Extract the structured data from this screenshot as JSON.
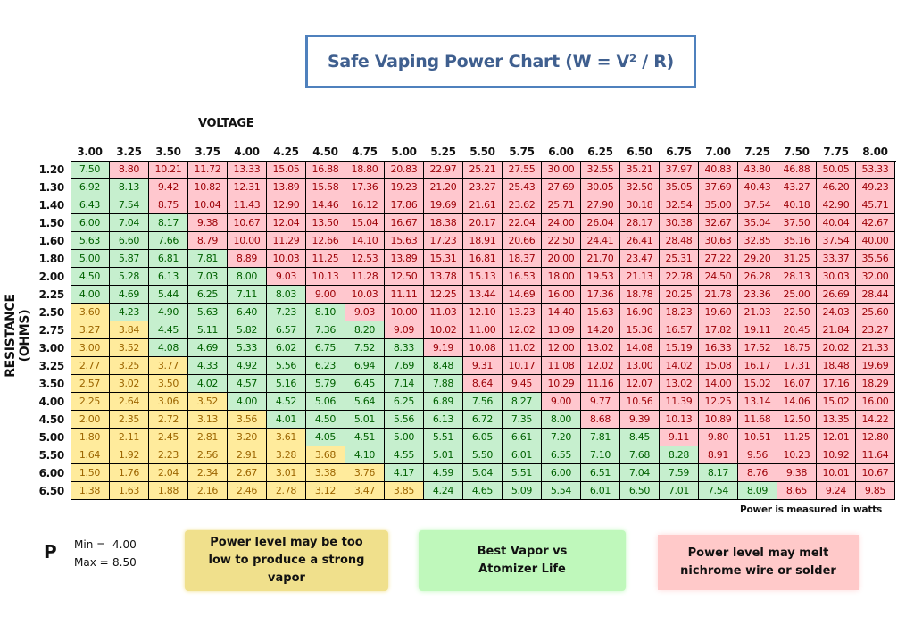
{
  "title": "Safe Vaping Power Chart (W = V² / R)",
  "chart_data": {
    "type": "table",
    "title": "Safe Vaping Power Chart (W = V² / R)",
    "xlabel": "VOLTAGE",
    "ylabel": "RESISTANCE (OHMS)",
    "units_note": "Power is measured in watts",
    "voltages": [
      "3.00",
      "3.25",
      "3.50",
      "3.75",
      "4.00",
      "4.25",
      "4.50",
      "4.75",
      "5.00",
      "5.25",
      "5.50",
      "5.75",
      "6.00",
      "6.25",
      "6.50",
      "6.75",
      "7.00",
      "7.25",
      "7.50",
      "7.75",
      "8.00"
    ],
    "resistances": [
      "1.20",
      "1.30",
      "1.40",
      "1.50",
      "1.60",
      "1.80",
      "2.00",
      "2.25",
      "2.50",
      "2.75",
      "3.00",
      "3.25",
      "3.50",
      "4.00",
      "4.50",
      "5.00",
      "5.50",
      "6.00",
      "6.50"
    ],
    "values": [
      [
        "7.50",
        "8.80",
        "10.21",
        "11.72",
        "13.33",
        "15.05",
        "16.88",
        "18.80",
        "20.83",
        "22.97",
        "25.21",
        "27.55",
        "30.00",
        "32.55",
        "35.21",
        "37.97",
        "40.83",
        "43.80",
        "46.88",
        "50.05",
        "53.33"
      ],
      [
        "6.92",
        "8.13",
        "9.42",
        "10.82",
        "12.31",
        "13.89",
        "15.58",
        "17.36",
        "19.23",
        "21.20",
        "23.27",
        "25.43",
        "27.69",
        "30.05",
        "32.50",
        "35.05",
        "37.69",
        "40.43",
        "43.27",
        "46.20",
        "49.23"
      ],
      [
        "6.43",
        "7.54",
        "8.75",
        "10.04",
        "11.43",
        "12.90",
        "14.46",
        "16.12",
        "17.86",
        "19.69",
        "21.61",
        "23.62",
        "25.71",
        "27.90",
        "30.18",
        "32.54",
        "35.00",
        "37.54",
        "40.18",
        "42.90",
        "45.71"
      ],
      [
        "6.00",
        "7.04",
        "8.17",
        "9.38",
        "10.67",
        "12.04",
        "13.50",
        "15.04",
        "16.67",
        "18.38",
        "20.17",
        "22.04",
        "24.00",
        "26.04",
        "28.17",
        "30.38",
        "32.67",
        "35.04",
        "37.50",
        "40.04",
        "42.67"
      ],
      [
        "5.63",
        "6.60",
        "7.66",
        "8.79",
        "10.00",
        "11.29",
        "12.66",
        "14.10",
        "15.63",
        "17.23",
        "18.91",
        "20.66",
        "22.50",
        "24.41",
        "26.41",
        "28.48",
        "30.63",
        "32.85",
        "35.16",
        "37.54",
        "40.00"
      ],
      [
        "5.00",
        "5.87",
        "6.81",
        "7.81",
        "8.89",
        "10.03",
        "11.25",
        "12.53",
        "13.89",
        "15.31",
        "16.81",
        "18.37",
        "20.00",
        "21.70",
        "23.47",
        "25.31",
        "27.22",
        "29.20",
        "31.25",
        "33.37",
        "35.56"
      ],
      [
        "4.50",
        "5.28",
        "6.13",
        "7.03",
        "8.00",
        "9.03",
        "10.13",
        "11.28",
        "12.50",
        "13.78",
        "15.13",
        "16.53",
        "18.00",
        "19.53",
        "21.13",
        "22.78",
        "24.50",
        "26.28",
        "28.13",
        "30.03",
        "32.00"
      ],
      [
        "4.00",
        "4.69",
        "5.44",
        "6.25",
        "7.11",
        "8.03",
        "9.00",
        "10.03",
        "11.11",
        "12.25",
        "13.44",
        "14.69",
        "16.00",
        "17.36",
        "18.78",
        "20.25",
        "21.78",
        "23.36",
        "25.00",
        "26.69",
        "28.44"
      ],
      [
        "3.60",
        "4.23",
        "4.90",
        "5.63",
        "6.40",
        "7.23",
        "8.10",
        "9.03",
        "10.00",
        "11.03",
        "12.10",
        "13.23",
        "14.40",
        "15.63",
        "16.90",
        "18.23",
        "19.60",
        "21.03",
        "22.50",
        "24.03",
        "25.60"
      ],
      [
        "3.27",
        "3.84",
        "4.45",
        "5.11",
        "5.82",
        "6.57",
        "7.36",
        "8.20",
        "9.09",
        "10.02",
        "11.00",
        "12.02",
        "13.09",
        "14.20",
        "15.36",
        "16.57",
        "17.82",
        "19.11",
        "20.45",
        "21.84",
        "23.27"
      ],
      [
        "3.00",
        "3.52",
        "4.08",
        "4.69",
        "5.33",
        "6.02",
        "6.75",
        "7.52",
        "8.33",
        "9.19",
        "10.08",
        "11.02",
        "12.00",
        "13.02",
        "14.08",
        "15.19",
        "16.33",
        "17.52",
        "18.75",
        "20.02",
        "21.33"
      ],
      [
        "2.77",
        "3.25",
        "3.77",
        "4.33",
        "4.92",
        "5.56",
        "6.23",
        "6.94",
        "7.69",
        "8.48",
        "9.31",
        "10.17",
        "11.08",
        "12.02",
        "13.00",
        "14.02",
        "15.08",
        "16.17",
        "17.31",
        "18.48",
        "19.69"
      ],
      [
        "2.57",
        "3.02",
        "3.50",
        "4.02",
        "4.57",
        "5.16",
        "5.79",
        "6.45",
        "7.14",
        "7.88",
        "8.64",
        "9.45",
        "10.29",
        "11.16",
        "12.07",
        "13.02",
        "14.00",
        "15.02",
        "16.07",
        "17.16",
        "18.29"
      ],
      [
        "2.25",
        "2.64",
        "3.06",
        "3.52",
        "4.00",
        "4.52",
        "5.06",
        "5.64",
        "6.25",
        "6.89",
        "7.56",
        "8.27",
        "9.00",
        "9.77",
        "10.56",
        "11.39",
        "12.25",
        "13.14",
        "14.06",
        "15.02",
        "16.00"
      ],
      [
        "2.00",
        "2.35",
        "2.72",
        "3.13",
        "3.56",
        "4.01",
        "4.50",
        "5.01",
        "5.56",
        "6.13",
        "6.72",
        "7.35",
        "8.00",
        "8.68",
        "9.39",
        "10.13",
        "10.89",
        "11.68",
        "12.50",
        "13.35",
        "14.22"
      ],
      [
        "1.80",
        "2.11",
        "2.45",
        "2.81",
        "3.20",
        "3.61",
        "4.05",
        "4.51",
        "5.00",
        "5.51",
        "6.05",
        "6.61",
        "7.20",
        "7.81",
        "8.45",
        "9.11",
        "9.80",
        "10.51",
        "11.25",
        "12.01",
        "12.80"
      ],
      [
        "1.64",
        "1.92",
        "2.23",
        "2.56",
        "2.91",
        "3.28",
        "3.68",
        "4.10",
        "4.55",
        "5.01",
        "5.50",
        "6.01",
        "6.55",
        "7.10",
        "7.68",
        "8.28",
        "8.91",
        "9.56",
        "10.23",
        "10.92",
        "11.64"
      ],
      [
        "1.50",
        "1.76",
        "2.04",
        "2.34",
        "2.67",
        "3.01",
        "3.38",
        "3.76",
        "4.17",
        "4.59",
        "5.04",
        "5.51",
        "6.00",
        "6.51",
        "7.04",
        "7.59",
        "8.17",
        "8.76",
        "9.38",
        "10.01",
        "10.67"
      ],
      [
        "1.38",
        "1.63",
        "1.88",
        "2.16",
        "2.46",
        "2.78",
        "3.12",
        "3.47",
        "3.85",
        "4.24",
        "4.65",
        "5.09",
        "5.54",
        "6.01",
        "6.50",
        "7.01",
        "7.54",
        "8.09",
        "8.65",
        "9.24",
        "9.85"
      ]
    ],
    "zones": [
      "BHHHHHHHHHHHHHHHHHHHH",
      "BBHHHHHHHHHHHHHHHHHHH",
      "BBHHHHHHHHHHHHHHHHHHH",
      "BBBHHHHHHHHHHHHHHHHHH",
      "BBBHHHHHHHHHHHHHHHHHH",
      "BBBBHHHHHHHHHHHHHHHHH",
      "BBBBBHHHHHHHHHHHHHHHH",
      "BBBBBBHHHHHHHHHHHHHHH",
      "LBBBBBBHHHHHHHHHHHHHH",
      "LLBBBBBBHHHHHHHHHHHHH",
      "LLBBBBBBBHHHHHHHHHHHH",
      "LLLBBBBBBBHHHHHHHHHHH",
      "LLLBBBBBBBHHHHHHHHHHH",
      "LLLLBBBBBBBBHHHHHHHHH",
      "LLLLLBBBBBBBBHHHHHHHH",
      "LLLLLLBBBBBBBBBHHHHHH",
      "LLLLLLLBBBBBBBBBHHHHH",
      "LLLLLLLLBBBBBBBBBHHHH",
      "LLLLLLLLLBBBBBBBBBHHH"
    ],
    "zone_colors": {
      "low": "#ffeb9c",
      "best": "#c6efce",
      "high": "#ffc7ce"
    },
    "thresholds": {
      "min": 4.0,
      "max": 8.5
    }
  },
  "params": {
    "symbol": "P",
    "min_label": "Min =",
    "min_value": "4.00",
    "max_label": "Max =",
    "max_value": "8.50"
  },
  "legend": {
    "low": "Power level may be too low to produce a strong vapor",
    "best": "Best Vapor vs Atomizer Life",
    "high": "Power level may melt nichrome wire or solder"
  }
}
